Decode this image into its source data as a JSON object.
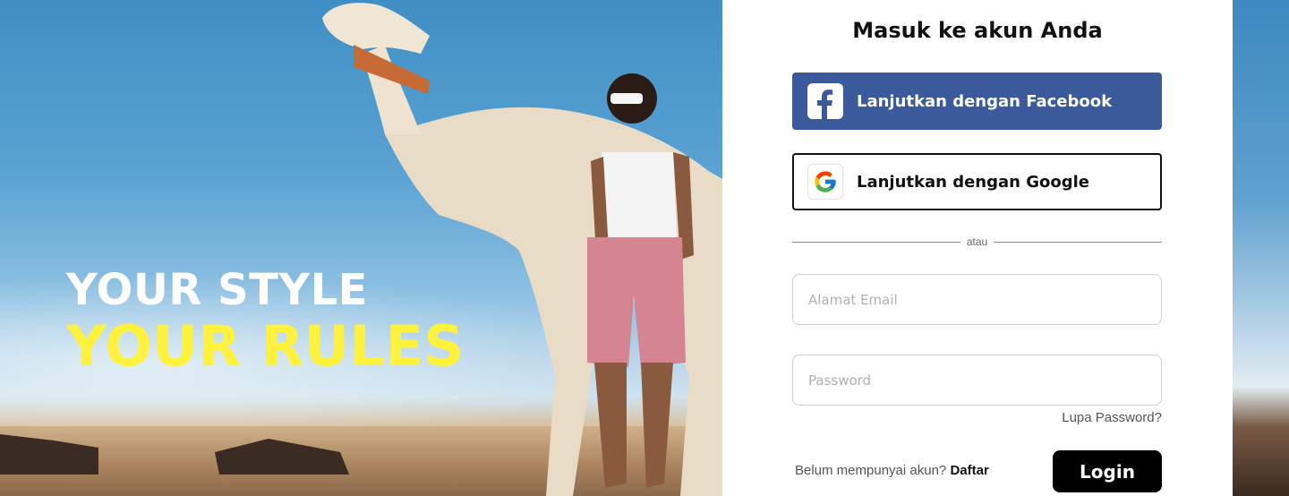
{
  "hero": {
    "line1": "YOUR STYLE",
    "line2": "YOUR RULES",
    "line1_color": "#ffffff",
    "line2_color": "#fff23a"
  },
  "login": {
    "title": "Masuk ke akun Anda",
    "facebook_label": "Lanjutkan dengan Facebook",
    "facebook_color": "#3b5a9b",
    "google_label": "Lanjutkan dengan Google",
    "divider_text": "atau",
    "email_placeholder": "Alamat Email",
    "email_value": "",
    "password_placeholder": "Password",
    "password_value": "",
    "forgot_label": "Lupa Password?",
    "signup_prompt": "Belum mempunyai akun?",
    "signup_link": "Daftar",
    "login_label": "Login"
  },
  "icons": {
    "facebook": "facebook-logo-icon",
    "google": "google-logo-icon"
  }
}
